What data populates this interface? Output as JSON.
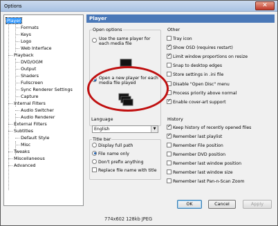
{
  "window": {
    "title": "Options",
    "close_glyph": "✕"
  },
  "tree": [
    {
      "label": "Player",
      "level": 0
    },
    {
      "label": "Formats",
      "level": 1
    },
    {
      "label": "Keys",
      "level": 1
    },
    {
      "label": "Logo",
      "level": 1
    },
    {
      "label": "Web Interface",
      "level": 1
    },
    {
      "label": "Playback",
      "level": 0
    },
    {
      "label": "DVD/OGM",
      "level": 1
    },
    {
      "label": "Output",
      "level": 1
    },
    {
      "label": "Shaders",
      "level": 1
    },
    {
      "label": "Fullscreen",
      "level": 1
    },
    {
      "label": "Sync Renderer Settings",
      "level": 1
    },
    {
      "label": "Capture",
      "level": 1
    },
    {
      "label": "Internal Filters",
      "level": 0
    },
    {
      "label": "Audio Switcher",
      "level": 1
    },
    {
      "label": "Audio Renderer",
      "level": 1
    },
    {
      "label": "External Filters",
      "level": 0
    },
    {
      "label": "Subtitles",
      "level": 0
    },
    {
      "label": "Default Style",
      "level": 1
    },
    {
      "label": "Misc",
      "level": 1
    },
    {
      "label": "Tweaks",
      "level": 0
    },
    {
      "label": "Miscellaneous",
      "level": 0
    },
    {
      "label": "Advanced",
      "level": 0
    }
  ],
  "panel": {
    "title": "Player",
    "open_options": {
      "label": "Open options",
      "same_player": "Use the same player for each media file",
      "new_player": "Open a new player for each media file played"
    },
    "language": {
      "label": "Language",
      "value": "English"
    },
    "title_bar": {
      "label": "Title bar",
      "display_full_path": "Display full path",
      "file_name_only": "File name only",
      "dont_prefix": "Don't prefix anything",
      "replace_with_title": "Replace file name with title"
    },
    "other": {
      "label": "Other",
      "items": [
        {
          "label": "Tray icon",
          "checked": false
        },
        {
          "label": "Show OSD (requires restart)",
          "checked": true
        },
        {
          "label": "Limit window proportions on resize",
          "checked": true
        },
        {
          "label": "Snap to desktop edges",
          "checked": false
        },
        {
          "label": "Store settings in .ini file",
          "checked": false
        },
        {
          "label": "Disable \"Open Disc\" menu",
          "checked": false
        },
        {
          "label": "Process priority above normal",
          "checked": false
        },
        {
          "label": "Enable cover-art support",
          "checked": true
        }
      ]
    },
    "history": {
      "label": "History",
      "items": [
        {
          "label": "Keep history of recently opened files",
          "checked": true
        },
        {
          "label": "Remember last playlist",
          "checked": true
        },
        {
          "label": "Remember File position",
          "checked": false
        },
        {
          "label": "Remember DVD position",
          "checked": false
        },
        {
          "label": "Remember last window position",
          "checked": false
        },
        {
          "label": "Remember last window size",
          "checked": false
        },
        {
          "label": "Remember last Pan-n-Scan Zoom",
          "checked": false
        }
      ]
    }
  },
  "buttons": {
    "ok": "OK",
    "cancel": "Cancel",
    "apply": "Apply"
  },
  "caption": "774x602 128kb JPEG",
  "colors": {
    "header": "#4a78b8",
    "selection": "#3399ff",
    "annotation": "#c01010"
  }
}
